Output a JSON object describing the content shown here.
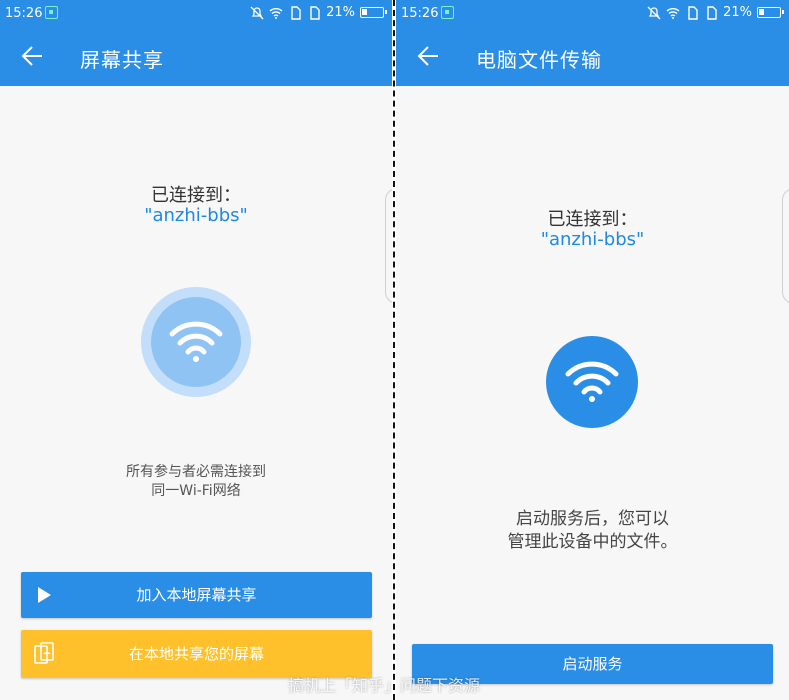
{
  "status_bar": {
    "time": "15:26",
    "battery": "21%",
    "icons": [
      "screenshot-icon",
      "bell-off-icon",
      "wifi-icon",
      "sim-icon",
      "sim-icon",
      "battery-icon"
    ]
  },
  "left": {
    "title": "屏幕共享",
    "connected_label": "已连接到：",
    "ssid": "\"anzhi-bbs\"",
    "hint_line1": "所有参与者必需连接到",
    "hint_line2": "同一Wi-Fi网络",
    "join_button": "加入本地屏幕共享",
    "share_button": "在本地共享您的屏幕"
  },
  "right": {
    "title": "电脑文件传输",
    "connected_label": "已连接到：",
    "ssid": "\"anzhi-bbs\"",
    "hint_line1": "启动服务后，您可以",
    "hint_line2": "管理此设备中的文件。",
    "start_button": "启动服务"
  },
  "watermark": "搞机上「知乎」问题下资源",
  "colors": {
    "primary": "#2b8ee6",
    "accent_yellow": "#fec02b",
    "ssid_blue": "#1e88e5"
  }
}
